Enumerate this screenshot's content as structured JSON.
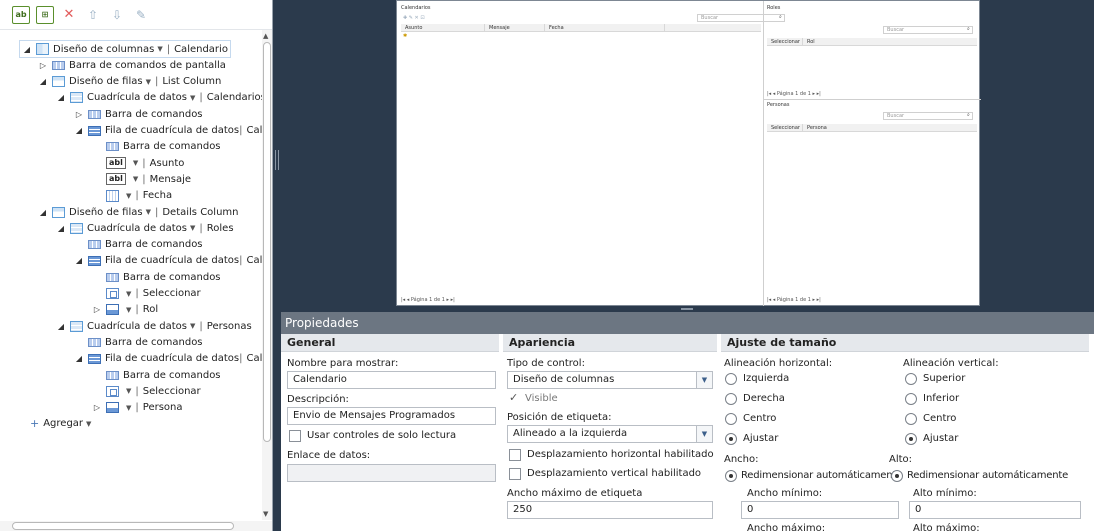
{
  "tree": {
    "nodes": [
      {
        "depth": 0,
        "exp": "◢",
        "icon": "col",
        "label": "Diseño de columnas",
        "dd": true,
        "tag": "Calendario",
        "selected": true
      },
      {
        "depth": 1,
        "exp": "▷",
        "icon": "bar",
        "label": "Barra de comandos de pantalla",
        "dd": false,
        "tag": ""
      },
      {
        "depth": 1,
        "exp": "◢",
        "icon": "rows",
        "label": "Diseño de filas",
        "dd": true,
        "tag": "List Column"
      },
      {
        "depth": 2,
        "exp": "◢",
        "icon": "grid",
        "label": "Cuadrícula de datos",
        "dd": true,
        "tag": "Calendarios"
      },
      {
        "depth": 3,
        "exp": "▷",
        "icon": "bar",
        "label": "Barra de comandos",
        "dd": false,
        "tag": ""
      },
      {
        "depth": 3,
        "exp": "◢",
        "icon": "grow",
        "label": "Fila de cuadrícula de datos",
        "dd": false,
        "tag": "Calendario"
      },
      {
        "depth": 4,
        "exp": "",
        "icon": "bar",
        "label": "Barra de comandos",
        "dd": false,
        "tag": ""
      },
      {
        "depth": 4,
        "exp": "",
        "icon": "abl",
        "label": "",
        "dd": true,
        "tag": "Asunto"
      },
      {
        "depth": 4,
        "exp": "",
        "icon": "abl",
        "label": "",
        "dd": true,
        "tag": "Mensaje"
      },
      {
        "depth": 4,
        "exp": "",
        "icon": "cal",
        "label": "",
        "dd": true,
        "tag": "Fecha"
      },
      {
        "depth": 1,
        "exp": "◢",
        "icon": "rows",
        "label": "Diseño de filas",
        "dd": true,
        "tag": "Details Column"
      },
      {
        "depth": 2,
        "exp": "◢",
        "icon": "grid",
        "label": "Cuadrícula de datos",
        "dd": true,
        "tag": "Roles"
      },
      {
        "depth": 3,
        "exp": "",
        "icon": "bar",
        "label": "Barra de comandos",
        "dd": false,
        "tag": ""
      },
      {
        "depth": 3,
        "exp": "◢",
        "icon": "grow",
        "label": "Fila de cuadrícula de datos",
        "dd": false,
        "tag": "Calendario"
      },
      {
        "depth": 4,
        "exp": "",
        "icon": "bar",
        "label": "Barra de comandos",
        "dd": false,
        "tag": ""
      },
      {
        "depth": 4,
        "exp": "",
        "icon": "sel",
        "label": "",
        "dd": true,
        "tag": "Seleccionar"
      },
      {
        "depth": 4,
        "exp": "▷",
        "icon": "ref",
        "label": "",
        "dd": true,
        "tag": "Rol"
      },
      {
        "depth": 2,
        "exp": "◢",
        "icon": "grid",
        "label": "Cuadrícula de datos",
        "dd": true,
        "tag": "Personas"
      },
      {
        "depth": 3,
        "exp": "",
        "icon": "bar",
        "label": "Barra de comandos",
        "dd": false,
        "tag": ""
      },
      {
        "depth": 3,
        "exp": "◢",
        "icon": "grow",
        "label": "Fila de cuadrícula de datos",
        "dd": false,
        "tag": "Calendario"
      },
      {
        "depth": 4,
        "exp": "",
        "icon": "bar",
        "label": "Barra de comandos",
        "dd": false,
        "tag": ""
      },
      {
        "depth": 4,
        "exp": "",
        "icon": "sel",
        "label": "",
        "dd": true,
        "tag": "Seleccionar"
      },
      {
        "depth": 4,
        "exp": "▷",
        "icon": "ref",
        "label": "",
        "dd": true,
        "tag": "Persona"
      }
    ],
    "add_label": "Agregar"
  },
  "preview": {
    "left_title": "Calendarios",
    "search_placeholder": "Buscar",
    "left_columns": [
      "Asunto",
      "Mensaje",
      "Fecha"
    ],
    "roles_title": "Roles",
    "roles_columns": [
      "Seleccionar",
      "Rol"
    ],
    "personas_title": "Personas",
    "personas_columns": [
      "Seleccionar",
      "Persona"
    ],
    "pager": "|◂  ◂  Página  1      de 1  ▸  ▸|"
  },
  "properties": {
    "title": "Propiedades",
    "general": {
      "header": "General",
      "display_name_label": "Nombre para mostrar:",
      "display_name_value": "Calendario",
      "description_label": "Descripción:",
      "description_value": "Envio de Mensajes Programados",
      "readonly_label": "Usar controles de solo lectura",
      "databinding_label": "Enlace de datos:"
    },
    "appearance": {
      "header": "Apariencia",
      "control_type_label": "Tipo de control:",
      "control_type_value": "Diseño de columnas",
      "visible_label": "Visible",
      "label_position_label": "Posición de etiqueta:",
      "label_position_value": "Alineado a la izquierda",
      "hscroll_label": "Desplazamiento horizontal habilitado",
      "vscroll_label": "Desplazamiento vertical habilitado",
      "max_label_width_label": "Ancho máximo de etiqueta",
      "max_label_width_value": "250"
    },
    "sizing": {
      "header": "Ajuste de tamaño",
      "halign_label": "Alineación horizontal:",
      "halign_options": [
        "Izquierda",
        "Derecha",
        "Centro",
        "Ajustar"
      ],
      "valign_label": "Alineación vertical:",
      "valign_options": [
        "Superior",
        "Inferior",
        "Centro",
        "Ajustar"
      ],
      "width_label": "Ancho:",
      "height_label": "Alto:",
      "auto_resize_label": "Redimensionar automáticamente",
      "min_width_label": "Ancho mínimo:",
      "min_width_value": "0",
      "min_height_label": "Alto mínimo:",
      "min_height_value": "0",
      "max_width_label": "Ancho máximo:",
      "max_height_label": "Alto máximo:"
    }
  }
}
